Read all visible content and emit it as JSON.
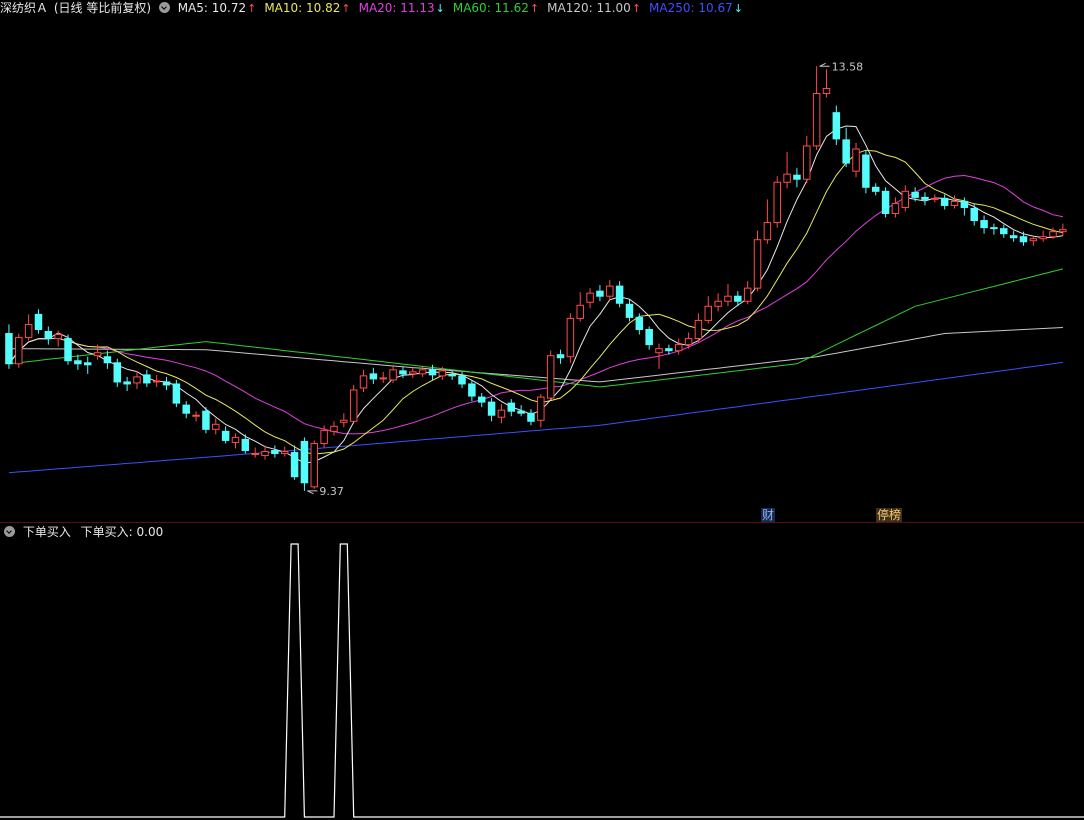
{
  "header": {
    "stock_name": "深纺织Ａ",
    "period": "(日线 等比前复权)",
    "ma": [
      {
        "label": "MA5: 10.72",
        "color": "#e8e8e8",
        "dir": "up"
      },
      {
        "label": "MA10: 10.82",
        "color": "#e8e85a",
        "dir": "up"
      },
      {
        "label": "MA20: 11.13",
        "color": "#e040e0",
        "dir": "down"
      },
      {
        "label": "MA60: 11.62",
        "color": "#30d030",
        "dir": "up"
      },
      {
        "label": "MA120: 11.00",
        "color": "#c8c8c8",
        "dir": "up"
      },
      {
        "label": "MA250: 10.67",
        "color": "#3c50ff",
        "dir": "down"
      }
    ]
  },
  "badges": {
    "cai": "财",
    "tingpang": "停榜"
  },
  "indicator": {
    "name": "下单买入",
    "value_label": "下单买入: 0.00"
  },
  "colors": {
    "up": "#ff4a4a",
    "down": "#54fcfc",
    "arrow_up": "#ff5050",
    "arrow_down": "#54fcfc",
    "indicator_line": "#ffffff"
  },
  "chart_data": {
    "type": "candlestick",
    "high_label": "13.58",
    "low_label": "9.37",
    "ylim": [
      9.2,
      13.9
    ],
    "candles": [
      [
        10.93,
        10.63,
        11.02,
        10.58
      ],
      [
        10.63,
        10.89,
        10.93,
        10.59
      ],
      [
        10.89,
        11.02,
        11.12,
        10.86
      ],
      [
        11.12,
        10.97,
        11.17,
        10.93
      ],
      [
        10.95,
        10.88,
        11.0,
        10.82
      ],
      [
        10.88,
        10.92,
        10.96,
        10.8
      ],
      [
        10.88,
        10.66,
        10.92,
        10.62
      ],
      [
        10.66,
        10.63,
        10.72,
        10.57
      ],
      [
        10.64,
        10.62,
        10.7,
        10.53
      ],
      [
        10.71,
        10.74,
        10.82,
        10.67
      ],
      [
        10.7,
        10.64,
        10.76,
        10.58
      ],
      [
        10.64,
        10.45,
        10.68,
        10.4
      ],
      [
        10.45,
        10.43,
        10.5,
        10.36
      ],
      [
        10.44,
        10.5,
        10.56,
        10.38
      ],
      [
        10.52,
        10.44,
        10.57,
        10.4
      ],
      [
        10.45,
        10.46,
        10.52,
        10.4
      ],
      [
        10.45,
        10.42,
        10.5,
        10.37
      ],
      [
        10.43,
        10.24,
        10.47,
        10.2
      ],
      [
        10.22,
        10.14,
        10.26,
        10.09
      ],
      [
        10.12,
        10.12,
        10.16,
        10.06
      ],
      [
        10.16,
        9.98,
        10.2,
        9.94
      ],
      [
        9.98,
        10.03,
        10.09,
        9.93
      ],
      [
        9.96,
        9.87,
        10.01,
        9.84
      ],
      [
        9.85,
        9.9,
        9.94,
        9.79
      ],
      [
        9.88,
        9.77,
        9.93,
        9.74
      ],
      [
        9.74,
        9.74,
        9.8,
        9.7
      ],
      [
        9.72,
        9.76,
        9.82,
        9.68
      ],
      [
        9.77,
        9.74,
        9.82,
        9.7
      ],
      [
        9.74,
        9.76,
        9.81,
        9.71
      ],
      [
        9.75,
        9.51,
        9.82,
        9.48
      ],
      [
        9.86,
        9.45,
        9.9,
        9.37
      ],
      [
        9.41,
        9.84,
        9.87,
        9.39
      ],
      [
        9.84,
        9.97,
        10.02,
        9.8
      ],
      [
        9.96,
        10.01,
        10.06,
        9.92
      ],
      [
        10.05,
        10.07,
        10.14,
        10.0
      ],
      [
        10.06,
        10.37,
        10.42,
        10.05
      ],
      [
        10.39,
        10.51,
        10.57,
        10.35
      ],
      [
        10.53,
        10.48,
        10.59,
        10.43
      ],
      [
        10.49,
        10.49,
        10.55,
        10.44
      ],
      [
        10.47,
        10.57,
        10.62,
        10.44
      ],
      [
        10.56,
        10.53,
        10.6,
        10.49
      ],
      [
        10.53,
        10.55,
        10.6,
        10.49
      ],
      [
        10.53,
        10.57,
        10.61,
        10.5
      ],
      [
        10.57,
        10.52,
        10.62,
        10.47
      ],
      [
        10.51,
        10.56,
        10.6,
        10.47
      ],
      [
        10.52,
        10.51,
        10.56,
        10.47
      ],
      [
        10.51,
        10.43,
        10.55,
        10.39
      ],
      [
        10.43,
        10.31,
        10.47,
        10.26
      ],
      [
        10.3,
        10.25,
        10.34,
        10.2
      ],
      [
        10.25,
        10.12,
        10.29,
        10.06
      ],
      [
        10.1,
        10.17,
        10.23,
        10.04
      ],
      [
        10.24,
        10.16,
        10.28,
        10.11
      ],
      [
        10.16,
        10.14,
        10.22,
        10.11
      ],
      [
        10.14,
        10.06,
        10.18,
        10.02
      ],
      [
        10.07,
        10.3,
        10.33,
        10.0
      ],
      [
        10.29,
        10.71,
        10.76,
        10.27
      ],
      [
        10.72,
        10.69,
        10.77,
        10.63
      ],
      [
        10.7,
        11.08,
        11.13,
        10.64
      ],
      [
        11.08,
        11.21,
        11.34,
        11.05
      ],
      [
        11.24,
        11.33,
        11.38,
        11.18
      ],
      [
        11.35,
        11.3,
        11.41,
        11.25
      ],
      [
        11.3,
        11.4,
        11.46,
        11.26
      ],
      [
        11.4,
        11.23,
        11.45,
        11.19
      ],
      [
        11.22,
        11.09,
        11.27,
        11.05
      ],
      [
        11.09,
        10.97,
        11.13,
        10.92
      ],
      [
        10.97,
        10.82,
        11.0,
        10.77
      ],
      [
        10.74,
        10.78,
        10.83,
        10.58
      ],
      [
        10.78,
        10.76,
        10.82,
        10.72
      ],
      [
        10.76,
        10.82,
        10.88,
        10.72
      ],
      [
        10.82,
        10.88,
        10.94,
        10.78
      ],
      [
        10.88,
        11.06,
        11.13,
        10.84
      ],
      [
        11.06,
        11.2,
        11.3,
        11.03
      ],
      [
        11.2,
        11.25,
        11.33,
        11.15
      ],
      [
        11.25,
        11.3,
        11.42,
        11.2
      ],
      [
        11.3,
        11.25,
        11.35,
        11.2
      ],
      [
        11.25,
        11.38,
        11.45,
        11.22
      ],
      [
        11.38,
        11.86,
        11.95,
        11.35
      ],
      [
        11.86,
        12.03,
        12.26,
        11.82
      ],
      [
        12.03,
        12.43,
        12.49,
        11.98
      ],
      [
        12.43,
        12.51,
        12.73,
        12.37
      ],
      [
        12.5,
        12.46,
        12.57,
        12.38
      ],
      [
        12.46,
        12.79,
        12.89,
        12.42
      ],
      [
        12.79,
        13.31,
        13.58,
        12.75
      ],
      [
        13.31,
        13.36,
        13.55,
        13.27
      ],
      [
        13.12,
        12.86,
        13.19,
        12.8
      ],
      [
        12.85,
        12.62,
        12.97,
        12.58
      ],
      [
        12.54,
        12.76,
        12.82,
        12.48
      ],
      [
        12.7,
        12.38,
        12.75,
        12.32
      ],
      [
        12.38,
        12.34,
        12.42,
        12.3
      ],
      [
        12.34,
        12.12,
        12.38,
        12.08
      ],
      [
        12.12,
        12.22,
        12.28,
        12.08
      ],
      [
        12.18,
        12.34,
        12.4,
        12.14
      ],
      [
        12.33,
        12.28,
        12.38,
        12.24
      ],
      [
        12.28,
        12.26,
        12.33,
        12.2
      ],
      [
        12.26,
        12.27,
        12.31,
        12.23
      ],
      [
        12.27,
        12.2,
        12.31,
        12.16
      ],
      [
        12.2,
        12.24,
        12.3,
        12.17
      ],
      [
        12.24,
        12.18,
        12.28,
        12.1
      ],
      [
        12.17,
        12.05,
        12.22,
        12.0
      ],
      [
        12.05,
        11.98,
        12.1,
        11.92
      ],
      [
        11.98,
        11.97,
        12.02,
        11.91
      ],
      [
        11.97,
        11.92,
        12.01,
        11.88
      ],
      [
        11.9,
        11.88,
        11.95,
        11.84
      ],
      [
        11.89,
        11.84,
        11.94,
        11.8
      ],
      [
        11.85,
        11.87,
        11.9,
        11.8
      ],
      [
        11.87,
        11.89,
        11.95,
        11.84
      ],
      [
        11.89,
        11.94,
        11.98,
        11.87
      ],
      [
        11.94,
        11.96,
        12.02,
        11.9
      ]
    ],
    "indicator": {
      "name": "下单买入",
      "baseline": 0,
      "peak": 1,
      "spikes": [
        29,
        34
      ]
    }
  }
}
